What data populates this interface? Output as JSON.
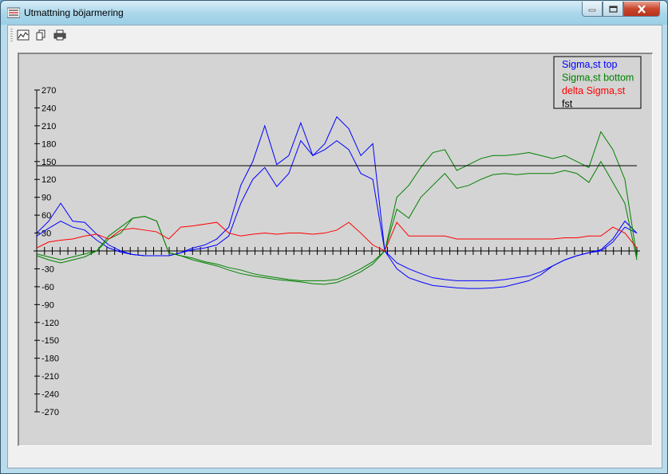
{
  "window": {
    "title": "Utmattning böjarmering"
  },
  "toolbar": {
    "icons": [
      "chart-icon",
      "copy-icon",
      "print-icon"
    ]
  },
  "chart_data": {
    "type": "line",
    "title": "",
    "xlabel": "",
    "ylabel": "",
    "ylim": [
      -270,
      270
    ],
    "y_ticks": [
      270,
      240,
      210,
      180,
      150,
      120,
      90,
      60,
      30,
      0,
      -30,
      -60,
      -90,
      -120,
      -150,
      -180,
      -210,
      -240,
      -270
    ],
    "y_tick_labels": [
      "270",
      "240",
      "210",
      "180",
      "150",
      "120",
      "90",
      "60",
      "30",
      "",
      "-30",
      "-60",
      "-90",
      "-120",
      "-150",
      "-180",
      "-210",
      "-240",
      "-270"
    ],
    "x_tick_count": 78,
    "grid": false,
    "legend_position": "top-right",
    "legend": [
      "Sigma,st top",
      "Sigma,st bottom",
      "delta Sigma,st",
      "fst"
    ],
    "colors": {
      "sigma_top": "#0000ff",
      "sigma_bottom": "#008000",
      "delta": "#ff0000",
      "fst": "#000000"
    },
    "x": [
      0,
      2,
      4,
      6,
      8,
      10,
      12,
      14,
      16,
      18,
      20,
      22,
      24,
      26,
      28,
      30,
      32,
      34,
      36,
      38,
      40,
      42,
      44,
      46,
      48,
      50,
      52,
      54,
      56,
      58,
      60,
      62,
      64,
      66,
      68,
      70,
      72,
      74,
      76,
      78,
      80,
      82,
      84,
      86,
      88,
      90,
      92,
      94,
      96,
      98,
      100
    ],
    "series": [
      {
        "name": "Sigma,st top",
        "color_key": "sigma_top",
        "values": [
          30,
          50,
          80,
          50,
          48,
          28,
          10,
          0,
          -6,
          -8,
          -8,
          -8,
          -3,
          5,
          10,
          20,
          40,
          110,
          150,
          210,
          145,
          160,
          215,
          160,
          180,
          225,
          205,
          160,
          180,
          0,
          -30,
          -45,
          -52,
          -58,
          -60,
          -62,
          -63,
          -63,
          -62,
          -60,
          -55,
          -50,
          -40,
          -25,
          -15,
          -8,
          -3,
          2,
          20,
          50,
          30
        ]
      },
      {
        "name": "Sigma,st top",
        "color_key": "sigma_top",
        "values": [
          25,
          38,
          50,
          40,
          35,
          18,
          5,
          -2,
          -6,
          -8,
          -8,
          -8,
          -3,
          2,
          5,
          10,
          25,
          80,
          120,
          140,
          108,
          130,
          185,
          160,
          170,
          185,
          170,
          130,
          120,
          0,
          -20,
          -30,
          -38,
          -45,
          -48,
          -50,
          -50,
          -50,
          -50,
          -48,
          -45,
          -42,
          -35,
          -25,
          -15,
          -8,
          -3,
          0,
          15,
          40,
          30
        ]
      },
      {
        "name": "Sigma,st bottom",
        "color_key": "sigma_bottom",
        "values": [
          -8,
          -15,
          -20,
          -15,
          -10,
          0,
          20,
          30,
          55,
          58,
          50,
          -3,
          -8,
          -15,
          -20,
          -25,
          -32,
          -38,
          -42,
          -45,
          -48,
          -50,
          -52,
          -55,
          -56,
          -53,
          -45,
          -35,
          -22,
          0,
          70,
          55,
          90,
          110,
          130,
          105,
          110,
          120,
          128,
          130,
          128,
          130,
          130,
          130,
          135,
          130,
          115,
          150,
          115,
          80,
          -15
        ]
      },
      {
        "name": "Sigma,st bottom",
        "color_key": "sigma_bottom",
        "values": [
          -5,
          -10,
          -15,
          -10,
          -5,
          0,
          25,
          40,
          55,
          58,
          50,
          -3,
          -8,
          -12,
          -18,
          -22,
          -28,
          -32,
          -38,
          -42,
          -45,
          -48,
          -50,
          -50,
          -50,
          -48,
          -40,
          -30,
          -18,
          0,
          90,
          110,
          140,
          165,
          170,
          135,
          145,
          155,
          160,
          160,
          162,
          165,
          160,
          155,
          160,
          150,
          140,
          200,
          170,
          120,
          -10
        ]
      },
      {
        "name": "delta Sigma,st",
        "color_key": "delta",
        "values": [
          5,
          15,
          18,
          20,
          25,
          28,
          20,
          35,
          38,
          35,
          32,
          20,
          40,
          42,
          45,
          48,
          30,
          25,
          28,
          30,
          28,
          30,
          30,
          28,
          30,
          35,
          48,
          30,
          10,
          0,
          48,
          25,
          25,
          25,
          25,
          20,
          20,
          20,
          20,
          20,
          20,
          20,
          20,
          20,
          22,
          22,
          25,
          25,
          40,
          30,
          5
        ]
      },
      {
        "name": "fst",
        "color_key": "fst",
        "values": [
          143,
          143,
          143,
          143,
          143,
          143,
          143,
          143,
          143,
          143,
          143,
          143,
          143,
          143,
          143,
          143,
          143,
          143,
          143,
          143,
          143,
          143,
          143,
          143,
          143,
          143,
          143,
          143,
          143,
          143,
          143,
          143,
          143,
          143,
          143,
          143,
          143,
          143,
          143,
          143,
          143,
          143,
          143,
          143,
          143,
          143,
          143,
          143,
          143,
          143,
          143
        ]
      }
    ]
  }
}
